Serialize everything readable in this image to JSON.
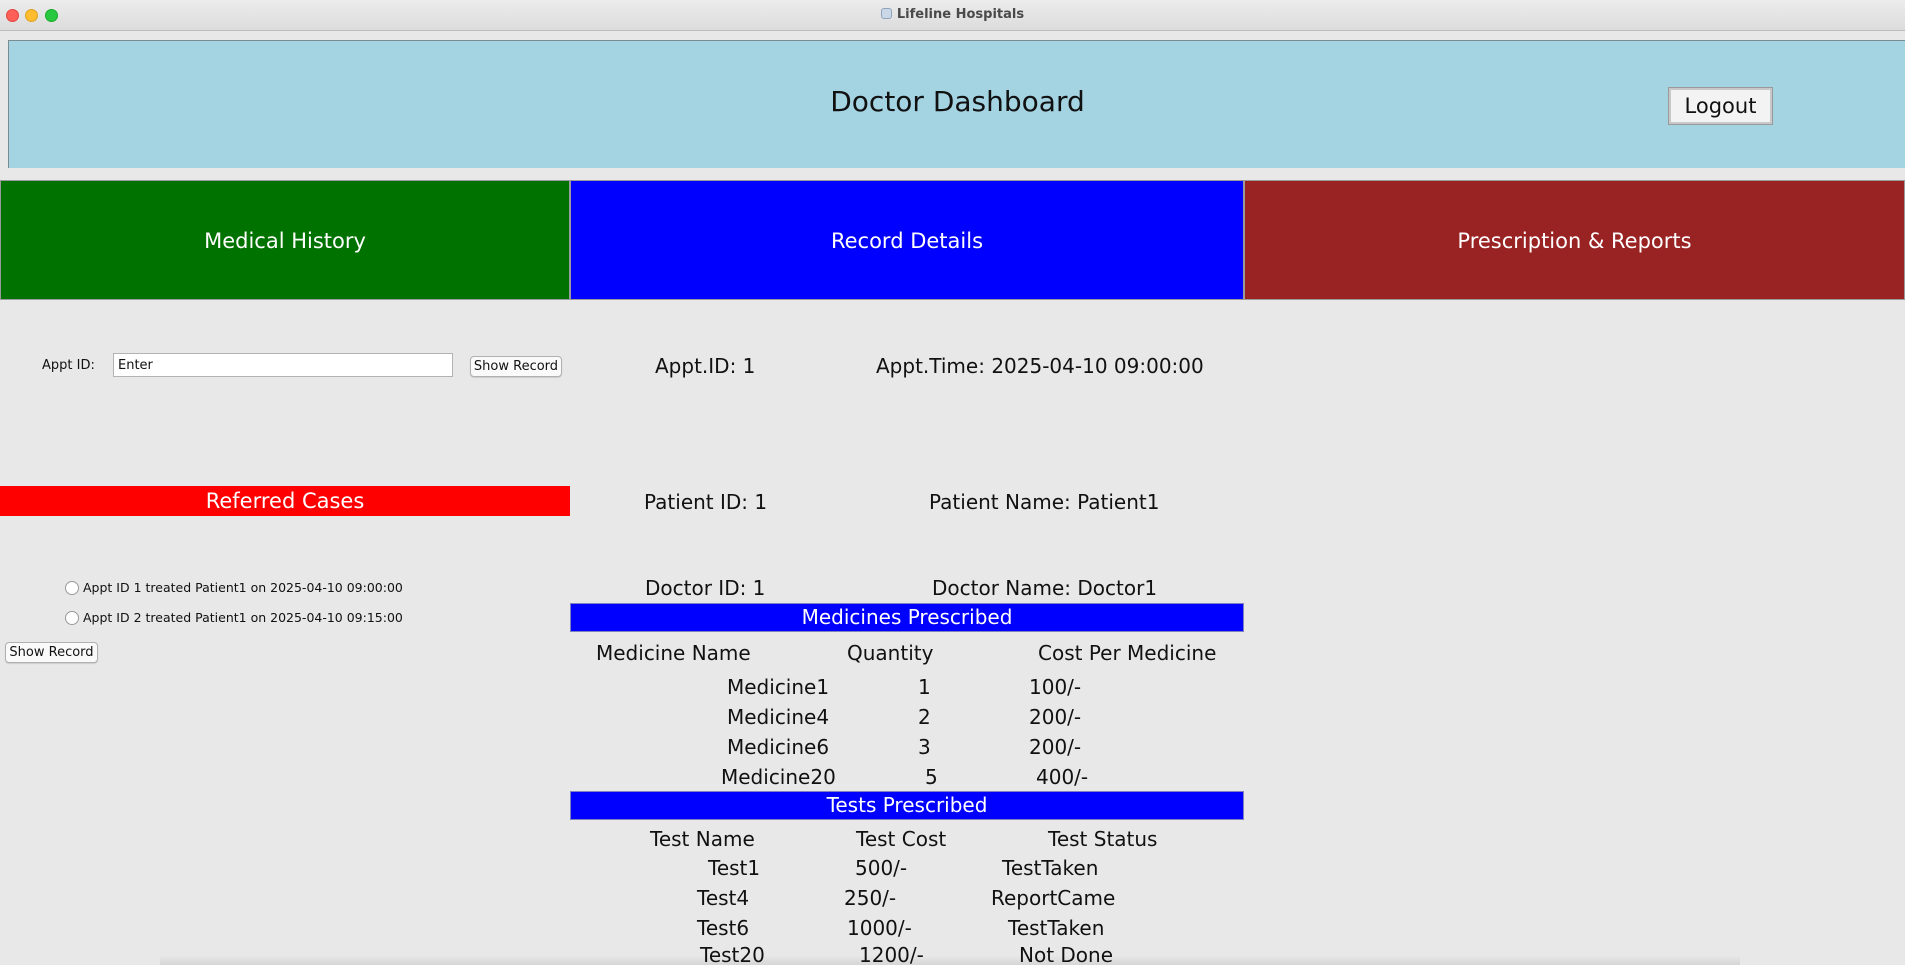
{
  "window": {
    "title": "Lifeline Hospitals"
  },
  "header": {
    "title": "Doctor Dashboard",
    "logout_label": "Logout"
  },
  "tabs": {
    "history": "Medical History",
    "record": "Record Details",
    "prescription": "Prescription & Reports"
  },
  "lookup": {
    "label": "Appt ID:",
    "input_value": "Enter",
    "button": "Show Record"
  },
  "record": {
    "appt_id": "Appt.ID: 1",
    "appt_time": "Appt.Time: 2025-04-10 09:00:00",
    "patient_id": "Patient ID: 1",
    "patient_name": "Patient Name: Patient1",
    "doctor_id": "Doctor ID: 1",
    "doctor_name": "Doctor Name: Doctor1"
  },
  "referred": {
    "title": "Referred Cases",
    "cases": [
      "Appt ID 1 treated Patient1 on 2025-04-10 09:00:00",
      "Appt ID 2 treated Patient1 on 2025-04-10 09:15:00"
    ],
    "button": "Show Record"
  },
  "medicines": {
    "title": "Medicines Prescribed",
    "headers": [
      "Medicine Name",
      "Quantity",
      "Cost Per Medicine"
    ],
    "rows": [
      [
        "Medicine1",
        "1",
        "100/-"
      ],
      [
        "Medicine4",
        "2",
        "200/-"
      ],
      [
        "Medicine6",
        "3",
        "200/-"
      ],
      [
        "Medicine20",
        "5",
        "400/-"
      ]
    ]
  },
  "tests": {
    "title": "Tests Prescribed",
    "headers": [
      "Test Name",
      "Test Cost",
      "Test Status"
    ],
    "rows": [
      [
        "Test1",
        "500/-",
        "TestTaken"
      ],
      [
        "Test4",
        "250/-",
        "ReportCame"
      ],
      [
        "Test6",
        "1000/-",
        "TestTaken"
      ],
      [
        "Test20",
        "1200/-",
        "Not Done"
      ]
    ]
  }
}
